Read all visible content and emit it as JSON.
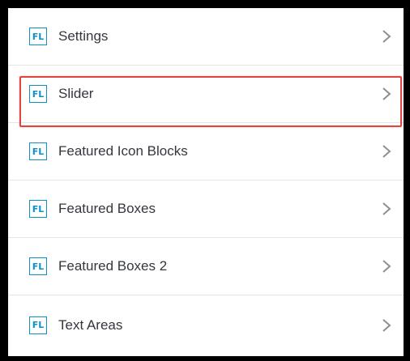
{
  "menu": {
    "items": [
      {
        "label": "Settings",
        "badge": "FL",
        "highlighted": false
      },
      {
        "label": "Slider",
        "badge": "FL",
        "highlighted": true
      },
      {
        "label": "Featured Icon Blocks",
        "badge": "FL",
        "highlighted": false
      },
      {
        "label": "Featured Boxes",
        "badge": "FL",
        "highlighted": false
      },
      {
        "label": "Featured Boxes 2",
        "badge": "FL",
        "highlighted": false
      },
      {
        "label": "Text Areas",
        "badge": "FL",
        "highlighted": false
      }
    ],
    "icons": {
      "badge": "fl-logo-icon",
      "chevron": "chevron-right-icon"
    }
  },
  "colors": {
    "frame": "#000000",
    "panel": "#ffffff",
    "badge": "#0e90c7",
    "label": "#33373d",
    "chevron": "#8c8f94",
    "divider": "#e5e5e5",
    "highlight": "#e0443f"
  }
}
